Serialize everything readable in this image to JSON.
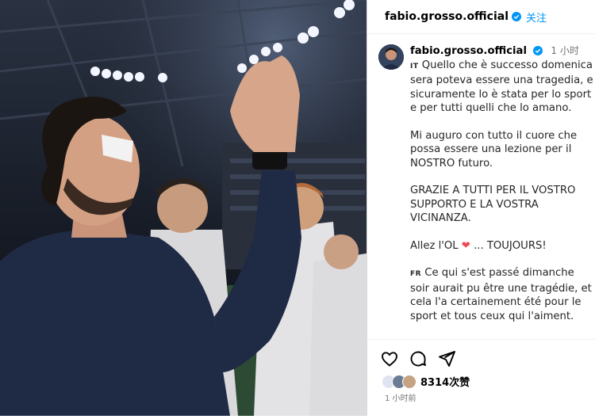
{
  "post": {
    "username": "fabio.grosso.official",
    "follow_label": "关注",
    "time_label": "1 小时",
    "verified_icon": "verified-badge-icon",
    "caption": {
      "lang_it": "IT",
      "p1": "Quello che è successo domenica sera poteva essere una tragedia, e sicuramente lo è stata per lo sport e per tutti quelli che lo amano.",
      "p2": "Mi auguro con tutto il cuore che possa essere una lezione per il NOSTRO futuro.",
      "p3": "GRAZIE A TUTTI PER IL VOSTRO SUPPORTO E LA VOSTRA VICINANZA.",
      "p4_pre": "Allez l'OL",
      "p4_post": "... TOUJOURS!",
      "lang_fr": "FR",
      "p5": "Ce qui s'est passé dimanche soir aurait pu être une tragédie, et cela l'a certainement été pour le sport et tous ceux qui l'aiment."
    },
    "likes_label": "8314次赞",
    "posted_ago": "1 小时前"
  },
  "colors": {
    "accent": "#0095f6",
    "heart": "#ed4956",
    "verified": "#0095f6"
  },
  "icons": [
    "heart-icon",
    "comment-icon",
    "share-icon"
  ]
}
